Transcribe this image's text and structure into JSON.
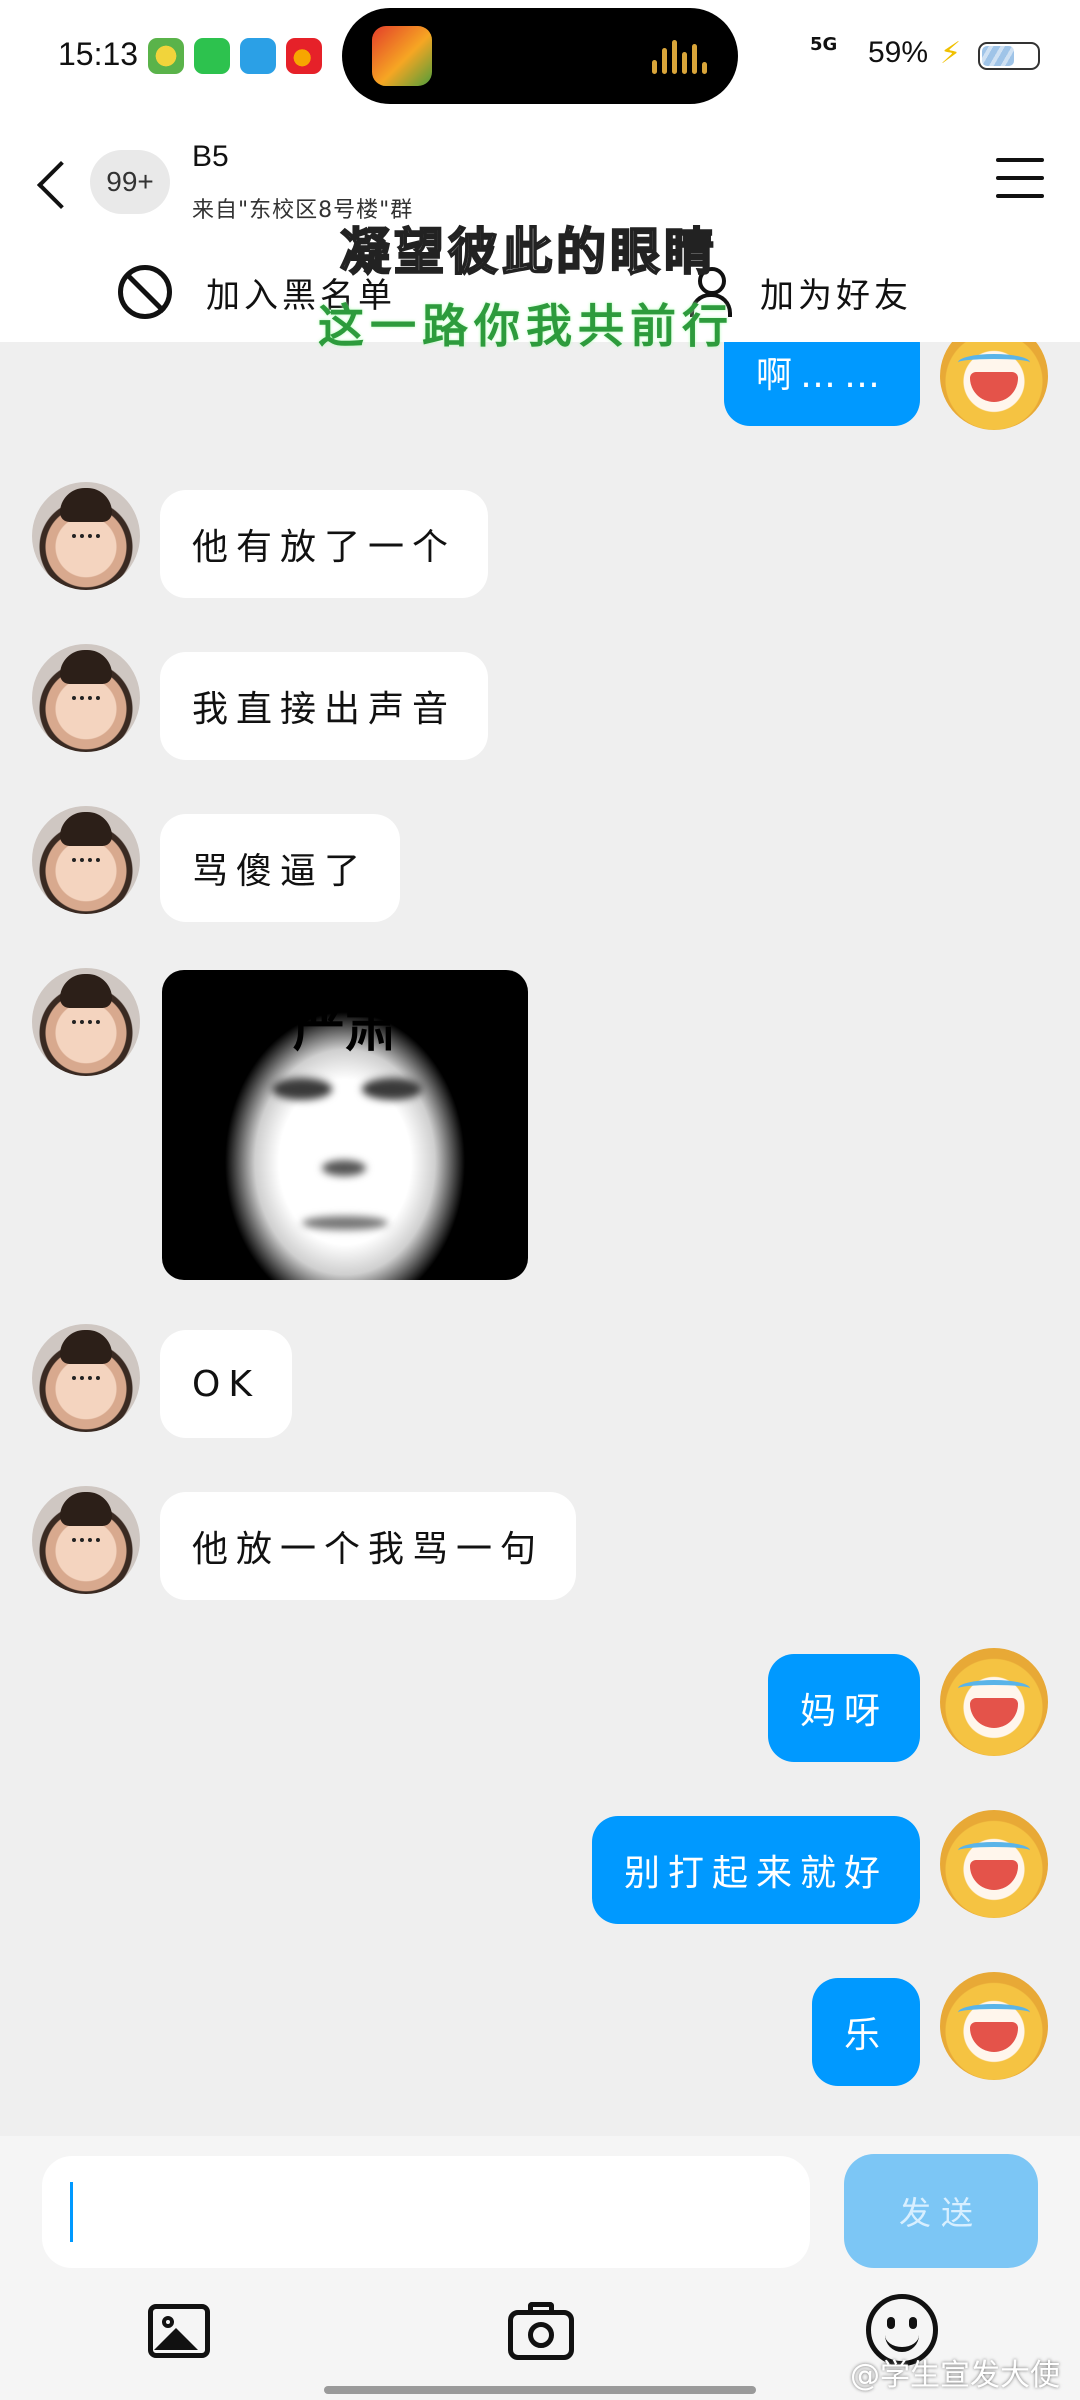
{
  "status_bar": {
    "time": "15:13",
    "network": "5G",
    "battery": "59%",
    "notification_apps": [
      "app-icon-1",
      "wechat-icon",
      "telegram-icon",
      "weibo-icon"
    ]
  },
  "header": {
    "back_icon": "chevron-left-icon",
    "unread_count": "99+",
    "title": "B5",
    "subtitle": "来自\"东校区8号楼\"群",
    "menu_icon": "hamburger-menu-icon",
    "block_label": "加入黑名单",
    "add_friend_label": "加为好友"
  },
  "overlay_lyrics": {
    "line1": "凝望彼此的眼睛",
    "line2": "这一路你我共前行"
  },
  "messages": [
    {
      "side": "out",
      "type": "text",
      "text": "啊……"
    },
    {
      "side": "in",
      "type": "text",
      "text": "他有放了一个"
    },
    {
      "side": "in",
      "type": "text",
      "text": "我直接出声音"
    },
    {
      "side": "in",
      "type": "text",
      "text": "骂傻逼了"
    },
    {
      "side": "in",
      "type": "sticker",
      "text": "严肃"
    },
    {
      "side": "in",
      "type": "text",
      "text": "OK"
    },
    {
      "side": "in",
      "type": "text",
      "text": "他放一个我骂一句"
    },
    {
      "side": "out",
      "type": "text",
      "text": "妈呀"
    },
    {
      "side": "out",
      "type": "text",
      "text": "别打起来就好"
    },
    {
      "side": "out",
      "type": "text",
      "text": "乐"
    }
  ],
  "input": {
    "placeholder": "",
    "send_label": "发送"
  },
  "watermark": "@学生宣发大使",
  "colors": {
    "outgoing_bubble": "#0099ff",
    "incoming_bubble": "#ffffff",
    "chat_background": "#efefef",
    "send_button_disabled": "#7cc6f5"
  }
}
